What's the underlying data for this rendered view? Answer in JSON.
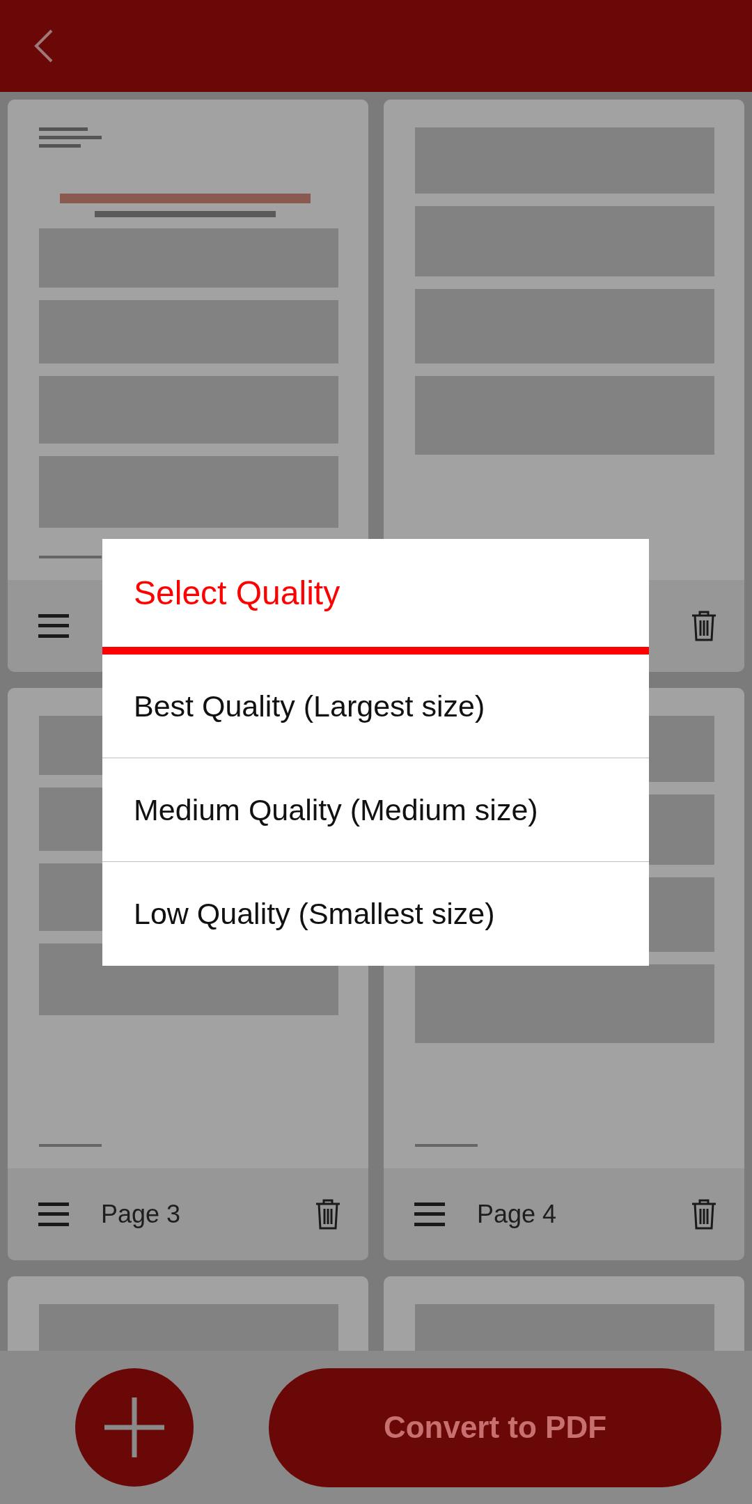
{
  "pages": [
    {
      "kind": "page",
      "menu": true,
      "delete": false
    },
    {
      "kind": "page",
      "menu": false,
      "delete": true
    },
    {
      "kind": "page",
      "label": "Page 3",
      "menu": true,
      "delete": true
    },
    {
      "kind": "page",
      "label": "Page 4",
      "menu": true,
      "delete": true
    },
    {
      "kind": "picture"
    },
    {
      "kind": "picture"
    }
  ],
  "bottom_bar": {
    "convert_label": "Convert to PDF"
  },
  "dialog": {
    "title": "Select Quality",
    "options": [
      {
        "label": "Best Quality (Largest size)"
      },
      {
        "label": "Medium Quality (Medium size)"
      },
      {
        "label": "Low Quality (Smallest size)"
      }
    ]
  }
}
